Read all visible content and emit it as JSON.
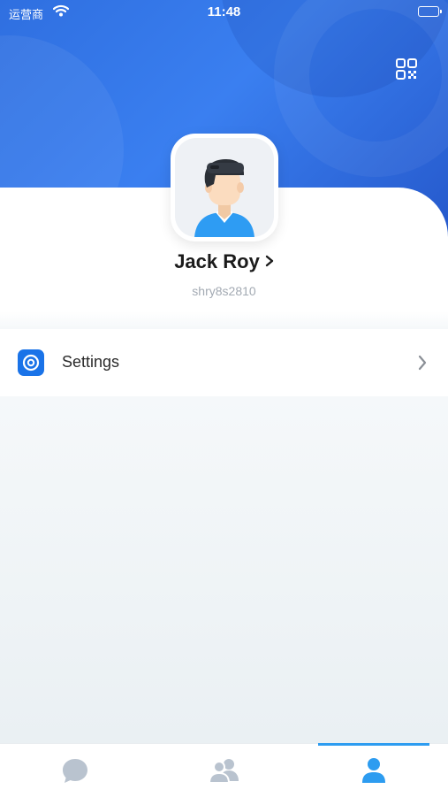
{
  "status_bar": {
    "carrier": "运营商",
    "time": "11:48"
  },
  "profile": {
    "name": "Jack Roy",
    "id": "shry8s2810"
  },
  "menu": {
    "items": [
      {
        "label": "Settings",
        "icon": "settings-icon"
      }
    ]
  },
  "tab_bar": {
    "tabs": [
      {
        "icon": "chat-bubble-icon",
        "active": false
      },
      {
        "icon": "contacts-icon",
        "active": false
      },
      {
        "icon": "person-icon",
        "active": true
      }
    ]
  },
  "colors": {
    "header_gradient_start": "#2f6fe0",
    "header_gradient_end": "#2456c9",
    "accent": "#1a73e8",
    "active_tab": "#2d9cf0",
    "inactive_tab": "#b9c3cf"
  }
}
